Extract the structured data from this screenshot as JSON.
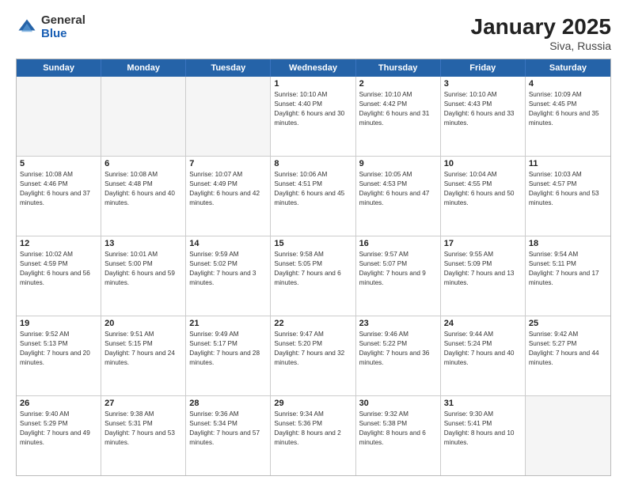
{
  "header": {
    "logo_general": "General",
    "logo_blue": "Blue",
    "month_year": "January 2025",
    "location": "Siva, Russia"
  },
  "days_of_week": [
    "Sunday",
    "Monday",
    "Tuesday",
    "Wednesday",
    "Thursday",
    "Friday",
    "Saturday"
  ],
  "weeks": [
    [
      {
        "day": "",
        "info": ""
      },
      {
        "day": "",
        "info": ""
      },
      {
        "day": "",
        "info": ""
      },
      {
        "day": "1",
        "info": "Sunrise: 10:10 AM\nSunset: 4:40 PM\nDaylight: 6 hours and 30 minutes."
      },
      {
        "day": "2",
        "info": "Sunrise: 10:10 AM\nSunset: 4:42 PM\nDaylight: 6 hours and 31 minutes."
      },
      {
        "day": "3",
        "info": "Sunrise: 10:10 AM\nSunset: 4:43 PM\nDaylight: 6 hours and 33 minutes."
      },
      {
        "day": "4",
        "info": "Sunrise: 10:09 AM\nSunset: 4:45 PM\nDaylight: 6 hours and 35 minutes."
      }
    ],
    [
      {
        "day": "5",
        "info": "Sunrise: 10:08 AM\nSunset: 4:46 PM\nDaylight: 6 hours and 37 minutes."
      },
      {
        "day": "6",
        "info": "Sunrise: 10:08 AM\nSunset: 4:48 PM\nDaylight: 6 hours and 40 minutes."
      },
      {
        "day": "7",
        "info": "Sunrise: 10:07 AM\nSunset: 4:49 PM\nDaylight: 6 hours and 42 minutes."
      },
      {
        "day": "8",
        "info": "Sunrise: 10:06 AM\nSunset: 4:51 PM\nDaylight: 6 hours and 45 minutes."
      },
      {
        "day": "9",
        "info": "Sunrise: 10:05 AM\nSunset: 4:53 PM\nDaylight: 6 hours and 47 minutes."
      },
      {
        "day": "10",
        "info": "Sunrise: 10:04 AM\nSunset: 4:55 PM\nDaylight: 6 hours and 50 minutes."
      },
      {
        "day": "11",
        "info": "Sunrise: 10:03 AM\nSunset: 4:57 PM\nDaylight: 6 hours and 53 minutes."
      }
    ],
    [
      {
        "day": "12",
        "info": "Sunrise: 10:02 AM\nSunset: 4:59 PM\nDaylight: 6 hours and 56 minutes."
      },
      {
        "day": "13",
        "info": "Sunrise: 10:01 AM\nSunset: 5:00 PM\nDaylight: 6 hours and 59 minutes."
      },
      {
        "day": "14",
        "info": "Sunrise: 9:59 AM\nSunset: 5:02 PM\nDaylight: 7 hours and 3 minutes."
      },
      {
        "day": "15",
        "info": "Sunrise: 9:58 AM\nSunset: 5:05 PM\nDaylight: 7 hours and 6 minutes."
      },
      {
        "day": "16",
        "info": "Sunrise: 9:57 AM\nSunset: 5:07 PM\nDaylight: 7 hours and 9 minutes."
      },
      {
        "day": "17",
        "info": "Sunrise: 9:55 AM\nSunset: 5:09 PM\nDaylight: 7 hours and 13 minutes."
      },
      {
        "day": "18",
        "info": "Sunrise: 9:54 AM\nSunset: 5:11 PM\nDaylight: 7 hours and 17 minutes."
      }
    ],
    [
      {
        "day": "19",
        "info": "Sunrise: 9:52 AM\nSunset: 5:13 PM\nDaylight: 7 hours and 20 minutes."
      },
      {
        "day": "20",
        "info": "Sunrise: 9:51 AM\nSunset: 5:15 PM\nDaylight: 7 hours and 24 minutes."
      },
      {
        "day": "21",
        "info": "Sunrise: 9:49 AM\nSunset: 5:17 PM\nDaylight: 7 hours and 28 minutes."
      },
      {
        "day": "22",
        "info": "Sunrise: 9:47 AM\nSunset: 5:20 PM\nDaylight: 7 hours and 32 minutes."
      },
      {
        "day": "23",
        "info": "Sunrise: 9:46 AM\nSunset: 5:22 PM\nDaylight: 7 hours and 36 minutes."
      },
      {
        "day": "24",
        "info": "Sunrise: 9:44 AM\nSunset: 5:24 PM\nDaylight: 7 hours and 40 minutes."
      },
      {
        "day": "25",
        "info": "Sunrise: 9:42 AM\nSunset: 5:27 PM\nDaylight: 7 hours and 44 minutes."
      }
    ],
    [
      {
        "day": "26",
        "info": "Sunrise: 9:40 AM\nSunset: 5:29 PM\nDaylight: 7 hours and 49 minutes."
      },
      {
        "day": "27",
        "info": "Sunrise: 9:38 AM\nSunset: 5:31 PM\nDaylight: 7 hours and 53 minutes."
      },
      {
        "day": "28",
        "info": "Sunrise: 9:36 AM\nSunset: 5:34 PM\nDaylight: 7 hours and 57 minutes."
      },
      {
        "day": "29",
        "info": "Sunrise: 9:34 AM\nSunset: 5:36 PM\nDaylight: 8 hours and 2 minutes."
      },
      {
        "day": "30",
        "info": "Sunrise: 9:32 AM\nSunset: 5:38 PM\nDaylight: 8 hours and 6 minutes."
      },
      {
        "day": "31",
        "info": "Sunrise: 9:30 AM\nSunset: 5:41 PM\nDaylight: 8 hours and 10 minutes."
      },
      {
        "day": "",
        "info": ""
      }
    ]
  ]
}
